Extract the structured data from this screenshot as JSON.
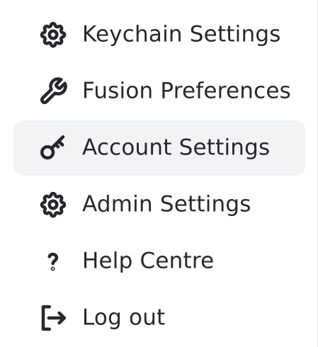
{
  "menu": {
    "items": [
      {
        "label": "Keychain Settings",
        "icon": "gear-icon",
        "active": false
      },
      {
        "label": "Fusion Preferences",
        "icon": "wrench-icon",
        "active": false
      },
      {
        "label": "Account Settings",
        "icon": "key-icon",
        "active": true
      },
      {
        "label": "Admin Settings",
        "icon": "gear-icon",
        "active": false
      },
      {
        "label": "Help Centre",
        "icon": "question-icon",
        "active": false
      },
      {
        "label": "Log out",
        "icon": "logout-icon",
        "active": false
      }
    ]
  },
  "colors": {
    "text": "#26282d",
    "active_background": "#f2f3f5",
    "background": "#ffffff"
  }
}
